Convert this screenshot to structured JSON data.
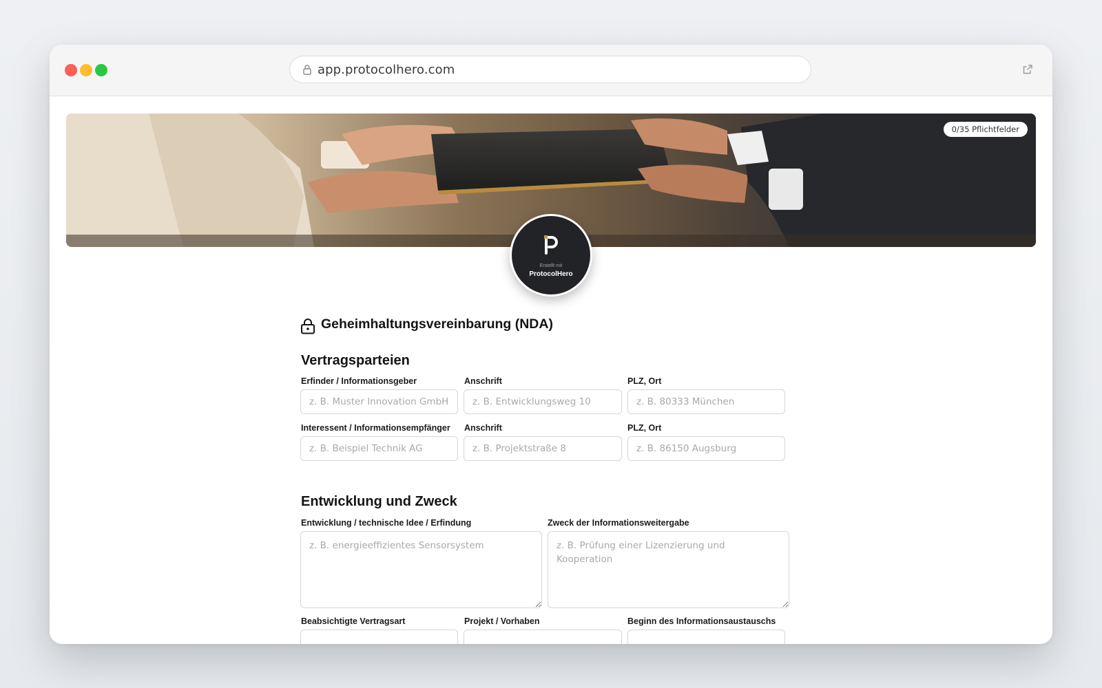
{
  "browser": {
    "url": "app.protocolhero.com"
  },
  "banner": {
    "required_badge": "0/35 Pflichtfelder"
  },
  "logo": {
    "caption": "Erstellt mit",
    "brand": "ProtocolHero"
  },
  "document": {
    "title": "Geheimhaltungsvereinbarung (NDA)"
  },
  "sections": {
    "parties": {
      "title": "Vertragsparteien",
      "discloser_label": "Erfinder / Informationsgeber",
      "discloser_placeholder": "z. B. Muster Innovation GmbH",
      "discloser_address_label": "Anschrift",
      "discloser_address_placeholder": "z. B. Entwicklungsweg 10",
      "discloser_city_label": "PLZ, Ort",
      "discloser_city_placeholder": "z. B. 80333 München",
      "recipient_label": "Interessent / Informationsempfänger",
      "recipient_placeholder": "z. B. Beispiel Technik AG",
      "recipient_address_label": "Anschrift",
      "recipient_address_placeholder": "z. B. Projektstraße 8",
      "recipient_city_label": "PLZ, Ort",
      "recipient_city_placeholder": "z. B. 86150 Augsburg"
    },
    "purpose": {
      "title": "Entwicklung und Zweck",
      "development_label": "Entwicklung / technische Idee / Erfindung",
      "development_placeholder": "z. B. energieeffizientes Sensorsystem",
      "purpose_label": "Zweck der Informationsweitergabe",
      "purpose_placeholder": "z. B. Prüfung einer Lizenzierung und Kooperation",
      "contract_type_label": "Beabsichtigte Vertragsart",
      "project_label": "Projekt / Vorhaben",
      "start_label": "Beginn des Informationsaustauschs"
    }
  },
  "colors": {
    "window_bg": "#ffffff",
    "titlebar_bg": "#f5f5f6",
    "traffic_red": "#fe5f57",
    "traffic_yellow": "#febc2e",
    "traffic_green": "#28c840",
    "logo_bg": "#222326",
    "input_border": "#d6d6da",
    "placeholder": "#a9a9ae"
  },
  "icons": {
    "url_lock": "lock-icon",
    "external": "external-link-icon",
    "title_lock": "lock-icon",
    "logo": "protocolhero-logo"
  }
}
